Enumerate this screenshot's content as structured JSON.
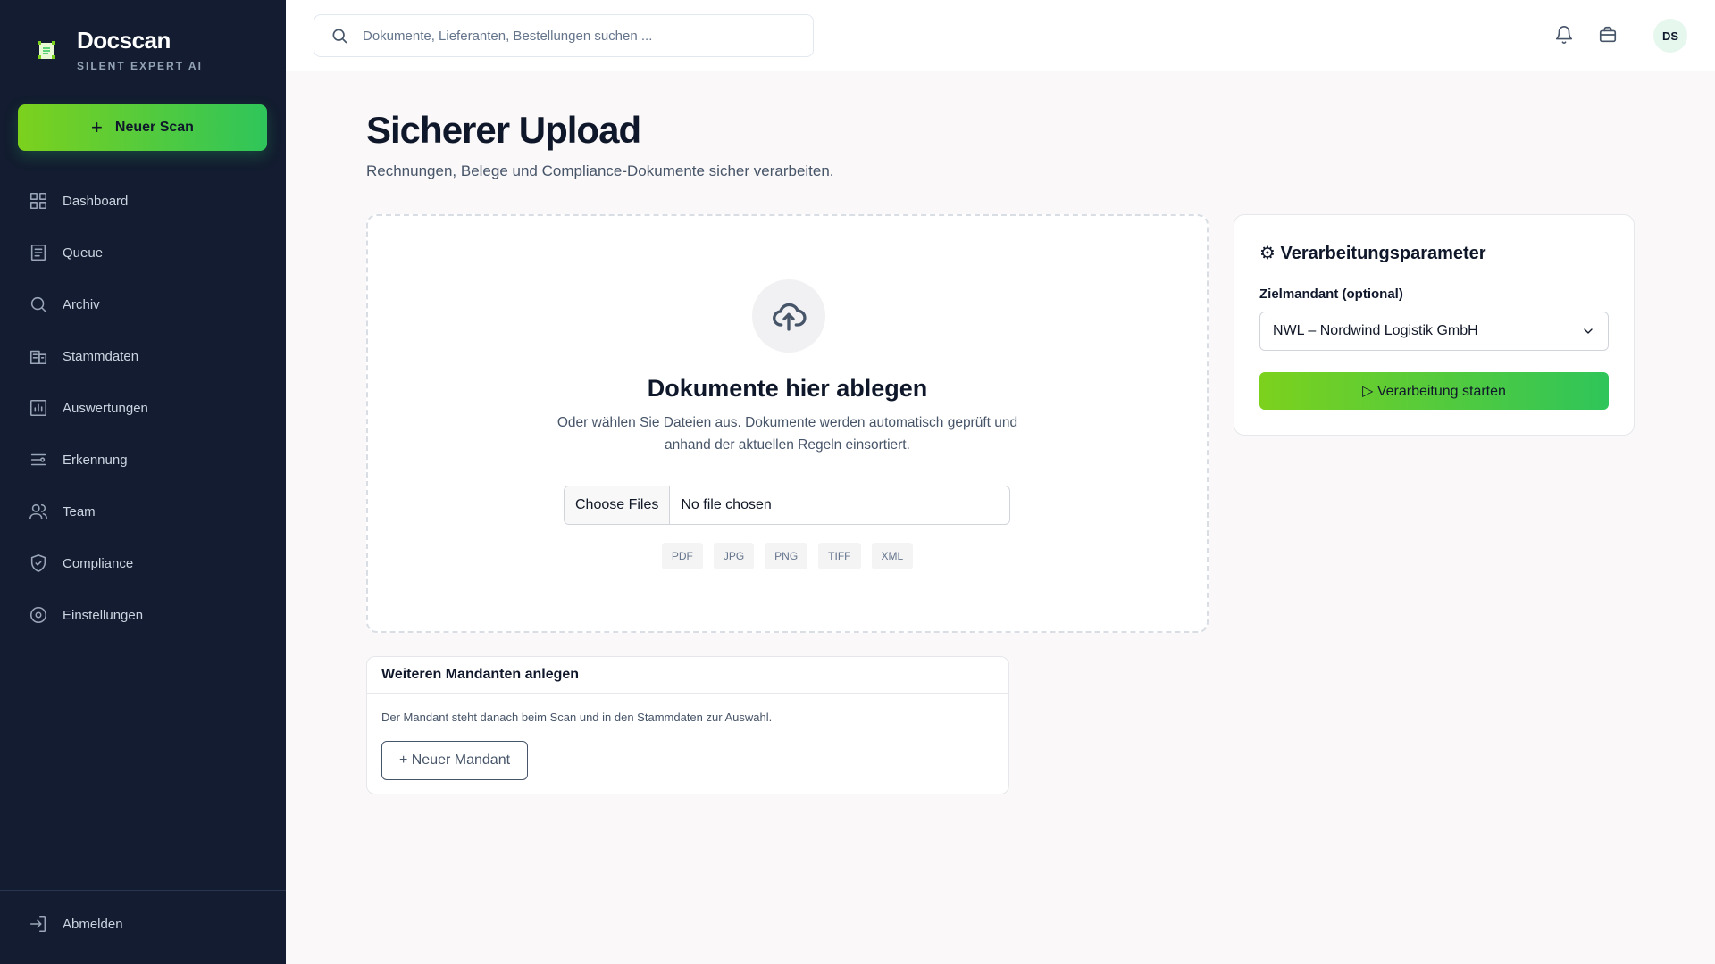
{
  "brand": {
    "name": "Docscan",
    "tagline": "SILENT EXPERT AI"
  },
  "sidebar": {
    "new_scan_label": "Neuer Scan",
    "items": [
      {
        "label": "Dashboard",
        "icon": "grid-icon"
      },
      {
        "label": "Queue",
        "icon": "list-icon"
      },
      {
        "label": "Archiv",
        "icon": "search-icon"
      },
      {
        "label": "Stammdaten",
        "icon": "building-icon"
      },
      {
        "label": "Auswertungen",
        "icon": "chart-icon"
      },
      {
        "label": "Erkennung",
        "icon": "filter-icon"
      },
      {
        "label": "Team",
        "icon": "users-icon"
      },
      {
        "label": "Compliance",
        "icon": "shield-icon"
      },
      {
        "label": "Einstellungen",
        "icon": "settings-icon"
      }
    ],
    "logout_label": "Abmelden"
  },
  "topbar": {
    "search_placeholder": "Dokumente, Lieferanten, Bestellungen suchen ...",
    "avatar_initials": "DS"
  },
  "page": {
    "title": "Sicherer Upload",
    "subtitle": "Rechnungen, Belege und Compliance-Dokumente sicher verarbeiten."
  },
  "dropzone": {
    "title": "Dokumente hier ablegen",
    "description": "Oder wählen Sie Dateien aus. Dokumente werden automatisch geprüft und anhand der aktuellen Regeln einsortiert.",
    "file_button": "Choose Files",
    "file_status": "No file chosen",
    "formats": [
      "PDF",
      "JPG",
      "PNG",
      "TIFF",
      "XML"
    ]
  },
  "params": {
    "title": "⚙ Verarbeitungsparameter",
    "field_label": "Zielmandant (optional)",
    "selected_value": "NWL – Nordwind Logistik GmbH",
    "start_label": "▷ Verarbeitung starten"
  },
  "mandant": {
    "title": "Weiteren Mandanten anlegen",
    "description": "Der Mandant steht danach beim Scan und in den Stammdaten zur Auswahl.",
    "button_label": "+ Neuer Mandant"
  },
  "colors": {
    "sidebar_bg": "#131c30",
    "accent_start": "#7cd11d",
    "accent_end": "#2fc55a"
  }
}
